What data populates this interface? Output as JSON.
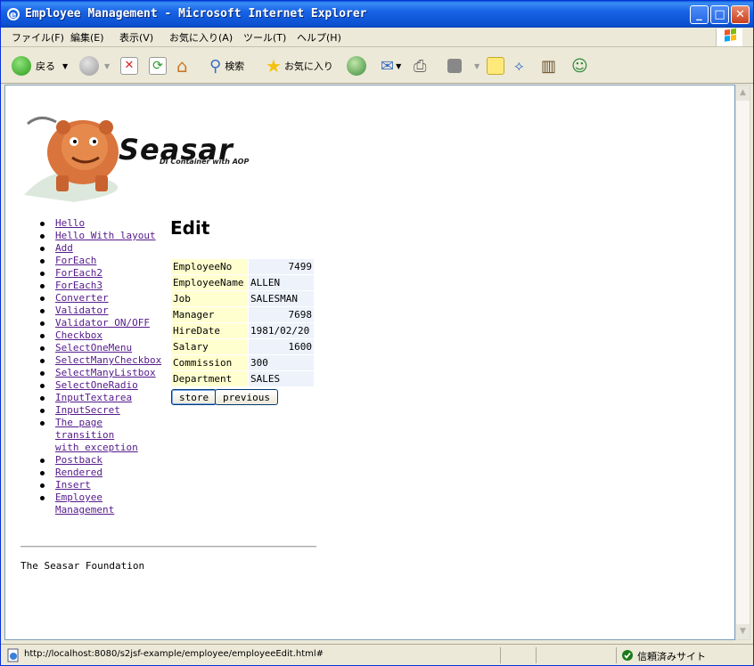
{
  "window": {
    "title": "Employee Management - Microsoft Internet Explorer"
  },
  "menu": [
    "ファイル(F)",
    "編集(E)",
    "表示(V)",
    "お気に入り(A)",
    "ツール(T)",
    "ヘルプ(H)"
  ],
  "toolbar": {
    "back_label": "戻る",
    "search_label": "検索",
    "favorites_label": "お気に入り"
  },
  "logo": {
    "title": "Seasar",
    "subtitle": "DI Container with AOP"
  },
  "nav": [
    "Hello",
    "Hello With layout",
    "Add",
    "ForEach",
    "ForEach2",
    "ForEach3",
    "Converter",
    "Validator",
    "Validator ON/OFF",
    "Checkbox",
    "SelectOneMenu",
    "SelectManyCheckbox",
    "SelectManyListbox",
    "SelectOneRadio",
    "InputTextarea",
    "InputSecret",
    "The page transition with exception",
    "Postback",
    "Rendered",
    "Insert",
    "Employee Management"
  ],
  "page": {
    "heading": "Edit",
    "fields": [
      {
        "label": "EmployeeNo",
        "value": "7499"
      },
      {
        "label": "EmployeeName",
        "value": "ALLEN"
      },
      {
        "label": "Job",
        "value": "SALESMAN"
      },
      {
        "label": "Manager",
        "value": "7698"
      },
      {
        "label": "HireDate",
        "value": "1981/02/20"
      },
      {
        "label": "Salary",
        "value": "1600"
      },
      {
        "label": "Commission",
        "value": "300"
      },
      {
        "label": "Department",
        "value": "SALES"
      }
    ],
    "store_label": "store",
    "previous_label": "previous",
    "footer": "The Seasar Foundation"
  },
  "status": {
    "url": "http://localhost:8080/s2jsf-example/employee/employeeEdit.html#",
    "zone": "信頼済みサイト"
  }
}
